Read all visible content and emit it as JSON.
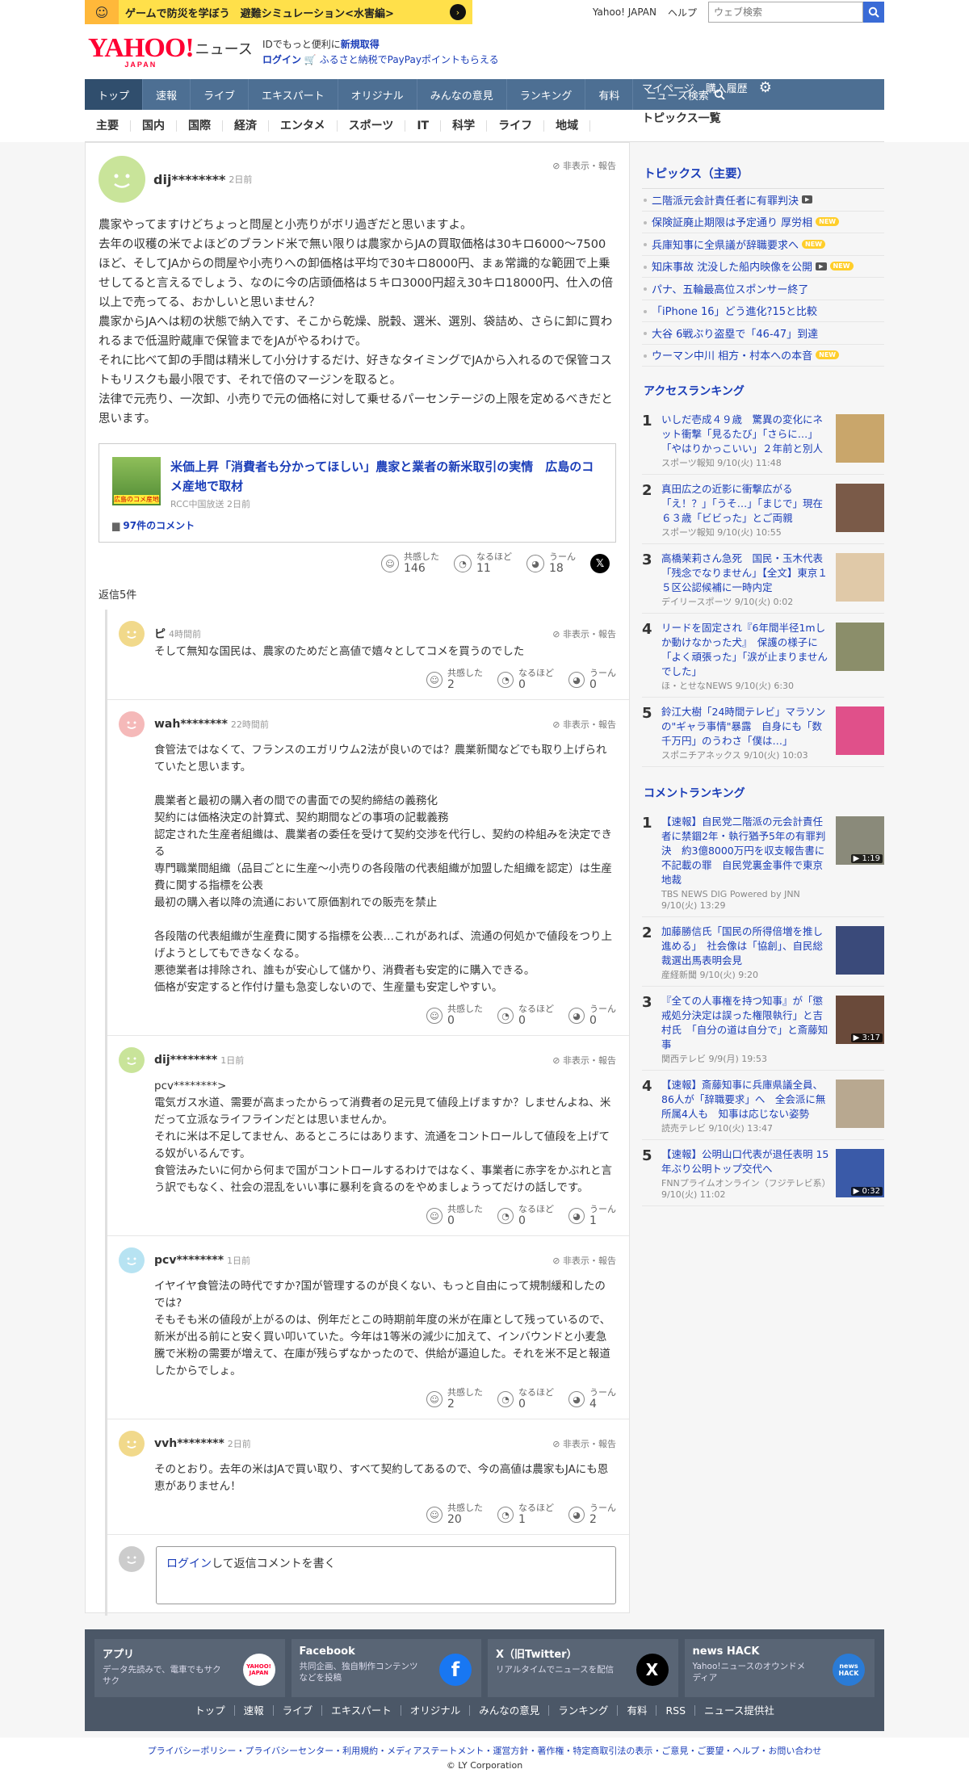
{
  "banner": {
    "text": "ゲームで防災を学ぼう　避難シミュレーション<水害編>"
  },
  "util": {
    "yahoo_japan": "Yahoo! JAPAN",
    "help": "ヘルプ",
    "search_placeholder": "ウェブ検索"
  },
  "logo": {
    "brand": "YAHOO!",
    "brand_sub": "JAPAN",
    "news": "ニュース"
  },
  "promo": {
    "line1_prefix": "IDでもっと便利に",
    "line1_link": "新規取得",
    "login": "ログイン",
    "line2": "ふるさと納税でPayPayポイントもらえる"
  },
  "mainnav": {
    "items": [
      "トップ",
      "速報",
      "ライブ",
      "エキスパート",
      "オリジナル",
      "みんなの意見",
      "ランキング",
      "有料",
      "ニュース検索"
    ],
    "mypage": "マイページ",
    "history": "購入履歴"
  },
  "subnav": {
    "items": [
      "主要",
      "国内",
      "国際",
      "経済",
      "エンタメ",
      "スポーツ",
      "IT",
      "科学",
      "ライフ",
      "地域"
    ],
    "topics_list": "トピックス一覧"
  },
  "comment": {
    "user": "dij********",
    "time": "2日前",
    "hide": "非表示・報告",
    "text": "農家やってますけどちょっと問屋と小売りがボリ過ぎだと思いますよ。\n去年の収穫の米でよほどのブランド米で無い限りは農家からJAの買取価格は30キロ6000〜7500ほど、そしてJAからの問屋や小売りへの卸価格は平均で30キロ8000円、まぁ常識的な範囲で上乗せしてると言えるでしょう、なのに今の店頭価格は５キロ3000円超え30キロ18000円、仕入の倍以上で売ってる、おかしいと思いません？\n農家からJAへは籾の状態で納入です、そこから乾燥、脱穀、選米、選別、袋詰め、さらに卸に買われるまで低温貯蔵庫で保管までをJAがやるわけで。\nそれに比べて卸の手間は精米して小分けするだけ、好きなタイミングでJAから入れるので保管コストもリスクも最小限です、それで倍のマージンを取ると。\n法律で元売り、一次卸、小売りで元の価格に対して乗せるパーセンテージの上限を定めるべきだと思います。",
    "article": {
      "title": "米価上昇「消費者も分かってほしい」農家と業者の新米取引の実情　広島のコメ産地で取材",
      "source": "RCC中国放送 2日前",
      "comments": "97件のコメント",
      "thumb_text": "広島のコメ産地"
    },
    "reactions": {
      "agree_label": "共感した",
      "agree": "146",
      "insight_label": "なるほど",
      "insight": "11",
      "hmm_label": "うーん",
      "hmm": "18"
    },
    "reply_count": "返信5件"
  },
  "replies": [
    {
      "user": "ピ",
      "time": "4時間前",
      "hide": "非表示・報告",
      "text": "そして無知な国民は、農家のためだと高値で嬉々としてコメを買うのでした",
      "agree": "2",
      "insight": "0",
      "hmm": "0",
      "color": "#f1d98b"
    },
    {
      "user": "wah********",
      "time": "22時間前",
      "hide": "非表示・報告",
      "text": "食管法ではなくて、フランスのエガリウム2法が良いのでは？農業新聞などでも取り上げられていたと思います。\n\n農業者と最初の購入者の間での書面での契約締結の義務化\n契約には価格決定の計算式、契約期間などの事項の記載義務\n認定された生産者組織は、農業者の委任を受けて契約交渉を代行し、契約の枠組みを決定できる\n専門職業間組織（品目ごとに生産〜小売りの各段階の代表組織が加盟した組織を認定）は生産費に関する指標を公表\n最初の購入者以降の流通において原価割れでの販売を禁止\n\n各段階の代表組織が生産費に関する指標を公表…これがあれば、流通の何処かで値段をつり上げようとしてもできなくなる。\n悪徳業者は排除され、誰もが安心して儲かり、消費者も安定的に購入できる。\n価格が安定すると作付け量も急変しないので、生産量も安定しやすい。",
      "agree": "0",
      "insight": "0",
      "hmm": "0",
      "color": "#f5b9b9"
    },
    {
      "user": "dij********",
      "time": "1日前",
      "hide": "非表示・報告",
      "text": "pcv********>\n電気ガス水道、需要が高まったからって消費者の足元見て値段上げますか？しませんよね、米だって立派なライフラインだとは思いませんか。\nそれに米は不足してません、あるところにはあります、流通をコントロールして値段を上げてる奴がいるんです。\n食管法みたいに何から何まで国がコントロールするわけではなく、事業者に赤字をかぶれと言う訳でもなく、社会の混乱をいい事に暴利を貪るのをやめましょうってだけの話しです。",
      "agree": "0",
      "insight": "0",
      "hmm": "1",
      "color": "#c9e49a"
    },
    {
      "user": "pcv********",
      "time": "1日前",
      "hide": "非表示・報告",
      "text": "イヤイヤ食管法の時代ですか?国が管理するのが良くない、もっと自由にって規制緩和したのでは?\nそもそも米の値段が上がるのは、例年だとこの時期前年度の米が在庫として残っているので、新米が出る前にと安く買い叩いていた。今年は1等米の減少に加えて、インバウンドと小麦急騰で米粉の需要が増えて、在庫が残らずなかったので、供給が逼迫した。それを米不足と報道したからでしょ。",
      "agree": "2",
      "insight": "0",
      "hmm": "4",
      "color": "#b7e3f2"
    },
    {
      "user": "vvh********",
      "time": "2日前",
      "hide": "非表示・報告",
      "text": "そのとおり。去年の米はJAで買い取り、すべて契約してあるので、今の高値は農家もJAにも恩恵がありません！",
      "agree": "20",
      "insight": "1",
      "hmm": "2",
      "color": "#f1d98b"
    }
  ],
  "reply_labels": {
    "agree": "共感した",
    "insight": "なるほど",
    "hmm": "うーん"
  },
  "login_reply": {
    "link": "ログイン",
    "text": "して返信コメントを書く"
  },
  "topics": {
    "title": "トピックス（主要）",
    "items": [
      {
        "text": "二階派元会計責任者に有罪判決",
        "badge": "video"
      },
      {
        "text": "保険証廃止期限は予定通り 厚労相",
        "badge": "NEW"
      },
      {
        "text": "兵庫知事に全県議が辞職要求へ",
        "badge": "NEW"
      },
      {
        "text": "知床事故 沈没した船内映像を公開",
        "badge": "video+NEW"
      },
      {
        "text": "パナ、五輪最高位スポンサー終了",
        "badge": ""
      },
      {
        "text": "「iPhone 16」どう進化?15と比較",
        "badge": ""
      },
      {
        "text": "大谷 6戦ぶり盗塁で「46-47」到達",
        "badge": ""
      },
      {
        "text": "ウーマン中川 相方・村本への本音",
        "badge": "NEW"
      }
    ]
  },
  "access_ranking": {
    "title": "アクセスランキング",
    "items": [
      {
        "no": "1",
        "title": "いしだ壱成４９歳　驚異の変化にネット衝撃「見るたび」「さらに…」「やはりかっこいい」２年前と別人",
        "source": "スポーツ報知 9/10(火) 11:48",
        "color": "#c9a66b"
      },
      {
        "no": "2",
        "title": "真田広之の近影に衝撃広がる「え！？」「うそ…」「まじで」現在６３歳「ビビった」とご両親",
        "source": "スポーツ報知 9/10(火) 10:55",
        "color": "#7a5a48"
      },
      {
        "no": "3",
        "title": "高橋茉莉さん急死　国民・玉木代表「残念でなりません」【全文】東京１５区公認候補に一時内定",
        "source": "デイリースポーツ 9/10(火) 0:02",
        "color": "#e0c9a8"
      },
      {
        "no": "4",
        "title": "リードを固定され『6年間半径1mしか動けなかった犬』　保護の様子に「よく頑張った」「涙が止まりませんでした」",
        "source": "ほ・とせなNEWS 9/10(火) 6:30",
        "color": "#8b8e6a"
      },
      {
        "no": "5",
        "title": "鈴江大樹「24時間テレビ」マラソンの\"ギャラ事情\"暴露　自身にも「数千万円」のうわさ「僕は…」",
        "source": "スポニチアネックス 9/10(火) 10:03",
        "color": "#e0508a"
      }
    ]
  },
  "comment_ranking": {
    "title": "コメントランキング",
    "items": [
      {
        "no": "1",
        "title": "【速報】自民党二階派の元会計責任者に禁錮2年・執行猶予5年の有罪判決　約3億8000万円を収支報告書に不記載の罪　自民党裏金事件で東京地裁",
        "source": "TBS NEWS DIG Powered by JNN 9/10(火) 13:29",
        "duration": "1:19",
        "color": "#8a8a7a"
      },
      {
        "no": "2",
        "title": "加藤勝信氏「国民の所得倍増を推し進める」　社会像は「協創」、自民総裁選出馬表明会見",
        "source": "産経新聞 9/10(火) 9:20",
        "duration": "",
        "color": "#3a4a7a"
      },
      {
        "no": "3",
        "title": "『全ての人事権を持つ知事』が「懲戒処分決定は誤った権限執行」と吉村氏　「自分の道は自分で」と斎藤知事",
        "source": "関西テレビ 9/9(月) 19:53",
        "duration": "3:17",
        "color": "#6a4a3a"
      },
      {
        "no": "4",
        "title": "【速報】斎藤知事に兵庫県議全員、86人が「辞職要求」へ　全会派に無所属4人も　知事は応じない姿勢",
        "source": "読売テレビ 9/10(火) 13:47",
        "duration": "",
        "color": "#b8a890"
      },
      {
        "no": "5",
        "title": "【速報】公明山口代表が退任表明 15年ぶり公明トップ交代へ",
        "source": "FNNプライムオンライン（フジテレビ系） 9/10(火) 11:02",
        "duration": "0:32",
        "color": "#3a5aa8"
      }
    ]
  },
  "footer": {
    "cards": [
      {
        "title": "アプリ",
        "desc": "データ先読みで、電車でもサクサク",
        "icon": "YAHOO! JAPAN"
      },
      {
        "title": "Facebook",
        "desc": "共同企画、独自制作コンテンツなどを投稿",
        "icon": "f"
      },
      {
        "title": "X（旧Twitter）",
        "desc": "リアルタイムでニュースを配信",
        "icon": "X"
      },
      {
        "title": "news HACK",
        "desc": "Yahoo!ニュースのオウンドメディア",
        "icon": "news HACK"
      }
    ],
    "links": [
      "トップ",
      "速報",
      "ライブ",
      "エキスパート",
      "オリジナル",
      "みんなの意見",
      "ランキング",
      "有料",
      "RSS",
      "ニュース提供社"
    ],
    "legal": "プライバシーポリシー・プライバシーセンター・利用規約・メディアステートメント・運営方針・著作権・特定商取引法の表示・ご意見・ご要望・ヘルプ・お問い合わせ",
    "copyright": "© LY Corporation"
  },
  "colors": {
    "link": "#1a3db8",
    "nav": "#4d6f93",
    "nav_active": "#304e6d",
    "footer": "#4b5767",
    "yahoo_red": "#ff0033"
  }
}
